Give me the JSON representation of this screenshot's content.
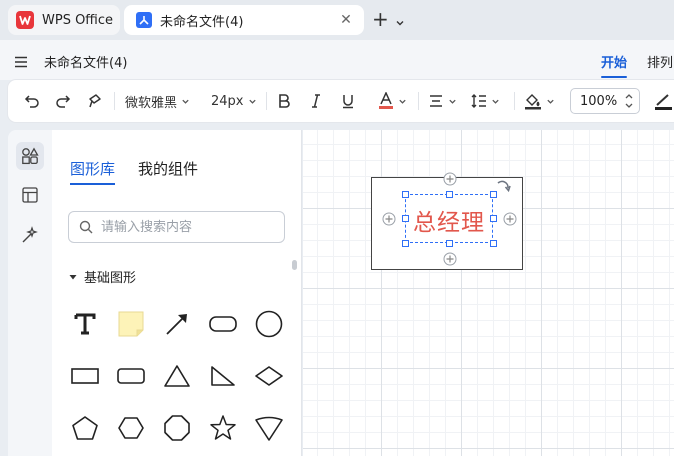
{
  "tabs": {
    "app_tab_label": "WPS Office",
    "doc_tab_label": "未命名文件(4)"
  },
  "titlebar": {
    "doc_title": "未命名文件(4)",
    "menu_start": "开始",
    "menu_arrange": "排列"
  },
  "toolbar": {
    "font_family": "微软雅黑",
    "font_size": "24px",
    "zoom": "100%",
    "font_color": "#e2574c"
  },
  "library": {
    "tab_shapes": "图形库",
    "tab_components": "我的组件",
    "search_placeholder": "请输入搜索内容",
    "section_basic": "基础图形",
    "shapes": [
      "text",
      "note",
      "arrow",
      "rounded-rectangle",
      "circle",
      "rectangle",
      "rounded-rectangle-2",
      "triangle",
      "right-triangle",
      "diamond",
      "pentagon",
      "hexagon",
      "octagon",
      "star",
      "inverted-shield"
    ]
  },
  "canvas": {
    "node_text": "总经理",
    "node_text_color": "#e2574c",
    "selection_color": "#2f6ff6"
  },
  "colors": {
    "accent": "#1a5fd8",
    "wps_red": "#e8363b"
  }
}
